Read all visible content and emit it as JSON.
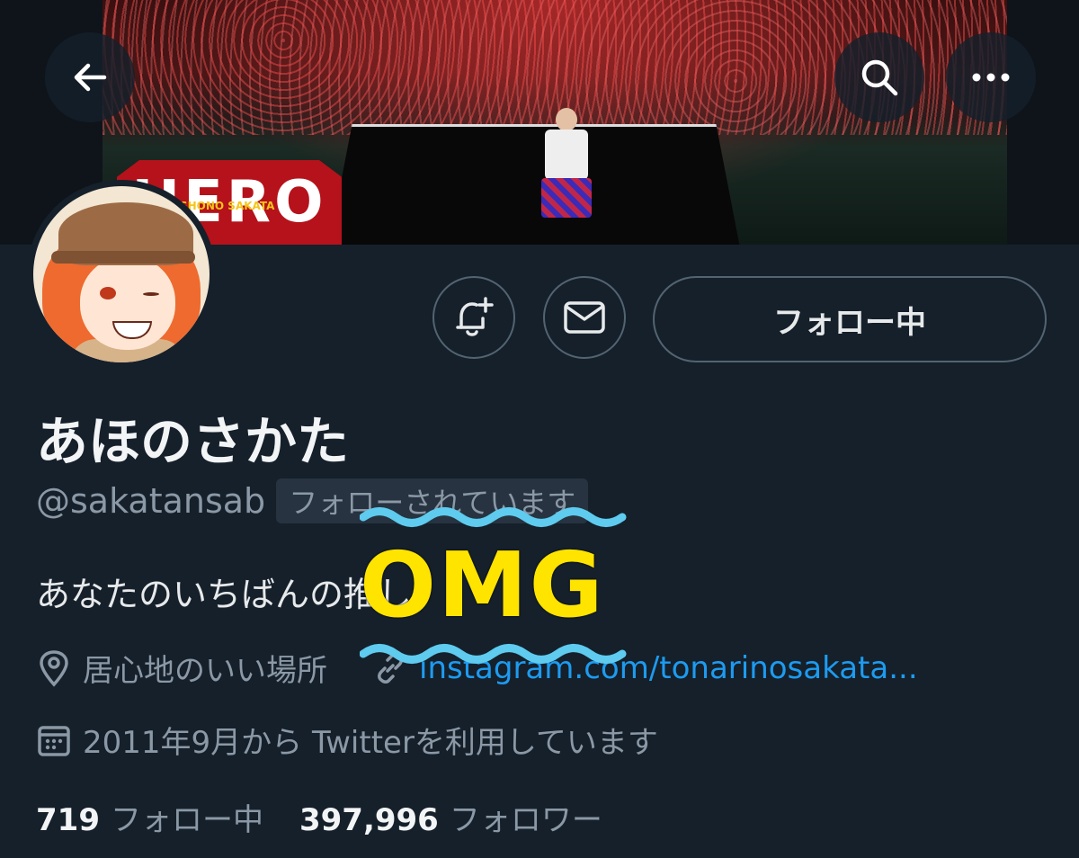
{
  "banner": {
    "logo_text": "HERO",
    "logo_small": "SHONO SAKATA"
  },
  "nav": {
    "back_icon": "arrow-left-icon",
    "search_icon": "search-icon",
    "more_icon": "more-dots-icon"
  },
  "actions": {
    "notify_icon": "bell-plus-icon",
    "message_icon": "mail-icon",
    "follow_label": "フォロー中"
  },
  "profile": {
    "display_name": "あほのさかた",
    "handle": "@sakatansab",
    "follows_you": "フォローされています",
    "bio": "あなたのいちばんの推し",
    "location": "居心地のいい場所",
    "website": "instagram.com/tonarinosakata...",
    "joined": "2011年9月から Twitterを利用しています"
  },
  "stats": {
    "following_count": "719",
    "following_label": "フォロー中",
    "followers_count": "397,996",
    "followers_label": "フォロワー"
  },
  "overlay": {
    "text": "OMG",
    "color": "#ffe400",
    "wave_color": "#5ecbef"
  },
  "colors": {
    "background": "#15202b",
    "secondary_text": "#8b98a5",
    "link": "#1d9bf0",
    "border": "#536471"
  }
}
